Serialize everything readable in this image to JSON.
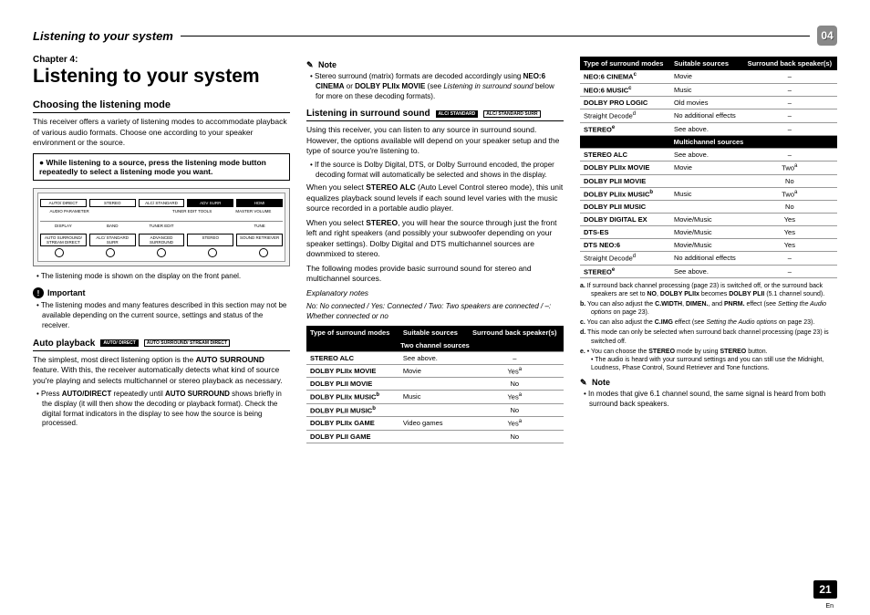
{
  "header": {
    "title": "Listening to your system",
    "chapter_badge": "04"
  },
  "col1": {
    "chapter_label": "Chapter 4:",
    "h1": "Listening to your system",
    "h2": "Choosing the listening mode",
    "p1": "This receiver offers a variety of listening modes to accommodate playback of various audio formats. Choose one according to your speaker environment or the source.",
    "box": "While listening to a source, press the listening mode button repeatedly to select a listening mode you want.",
    "note1": "The listening mode is shown on the display on the front panel.",
    "important_h": "Important",
    "important_p": "The listening modes and many features described in this section may not be available depending on the current source, settings and status of the receiver.",
    "auto_h": "Auto playback",
    "auto_btn1": "AUTO/\nDIRECT",
    "auto_btn2": "AUTO SURROUND/\nSTREAM DIRECT",
    "auto_p": "The simplest, most direct listening option is the AUTO SURROUND feature. With this, the receiver automatically detects what kind of source you're playing and selects multichannel or stereo playback as necessary.",
    "auto_note": "Press AUTO/DIRECT repeatedly until AUTO SURROUND shows briefly in the display (it will then show the decoding or playback format). Check the digital format indicators in the display to see how the source is being processed.",
    "device": {
      "row1": [
        "AUTO/\nDIRECT",
        "STEREO",
        "ALC/\nSTANDARD",
        "ADV SURR"
      ],
      "row1b": [
        "HDMI"
      ],
      "row2a": [
        "AUDIO\nPARAMETER",
        "",
        "TUNER EDIT\nTOOLS",
        "MASTER\nVOLUME"
      ],
      "row3": [
        "DISPLAY",
        "BAND",
        "TUNER EDIT",
        "",
        "TUNE"
      ],
      "row4": [
        "AUTO SURROUND/\nSTREAM DIRECT",
        "ALC/\nSTANDARD SURR",
        "ADVANCED\nSURROUND",
        "STEREO",
        "SOUND\nRETRIEVER"
      ]
    }
  },
  "col2": {
    "note_h": "Note",
    "note_p": "Stereo surround (matrix) formats are decoded accordingly using NEO:6 CINEMA or DOLBY PLIIx MOVIE (see Listening in surround sound below for more on these decoding formats).",
    "h3": "Listening in surround sound",
    "btn1": "ALC/\nSTANDARD",
    "btn2": "ALC/\nSTANDARD SURR",
    "p1": "Using this receiver, you can listen to any source in surround sound. However, the options available will depend on your speaker setup and the type of source you're listening to.",
    "bullet1": "If the source is Dolby Digital, DTS, or Dolby Surround encoded, the proper decoding format will automatically be selected and shows in the display.",
    "p2": "When you select STEREO ALC (Auto Level Control stereo mode), this unit equalizes playback sound levels if each sound level varies with the music source recorded in a portable audio player.",
    "p3": "When you select STEREO, you will hear the source through just the front left and right speakers (and possibly your subwoofer depending on your speaker settings). Dolby Digital and DTS multichannel sources are downmixed to stereo.",
    "p4": "The following modes provide basic surround sound for stereo and multichannel sources.",
    "exp_h": "Explanatory notes",
    "exp_p": "No: No connected / Yes: Connected / Two: Two speakers are connected / –: Whether connected or no",
    "th1": "Type of surround modes",
    "th2": "Suitable sources",
    "th3": "Surround back speaker(s)",
    "sec1": "Two channel sources",
    "rows": [
      {
        "m": "STEREO ALC",
        "s": "See above.",
        "b": "–"
      },
      {
        "m": "DOLBY PLIIx MOVIE",
        "s": "Movie",
        "b": "Yes",
        "sup": "a"
      },
      {
        "m": "DOLBY PLII MOVIE",
        "s": "",
        "b": "No"
      },
      {
        "m": "DOLBY PLIIx MUSIC",
        "msup": "b",
        "s": "Music",
        "b": "Yes",
        "sup": "a"
      },
      {
        "m": "DOLBY PLII MUSIC",
        "msup": "b",
        "s": "",
        "b": "No"
      },
      {
        "m": "DOLBY PLIIx GAME",
        "s": "Video games",
        "b": "Yes",
        "sup": "a"
      },
      {
        "m": "DOLBY PLII GAME",
        "s": "",
        "b": "No"
      }
    ]
  },
  "col3": {
    "th1": "Type of surround modes",
    "th2": "Suitable sources",
    "th3": "Surround back speaker(s)",
    "rows1": [
      {
        "m": "NEO:6 CINEMA",
        "msup": "c",
        "s": "Movie",
        "b": "–"
      },
      {
        "m": "NEO:6 MUSIC",
        "msup": "c",
        "s": "Music",
        "b": "–"
      },
      {
        "m": "DOLBY PRO LOGIC",
        "s": "Old movies",
        "b": "–"
      },
      {
        "m": "Straight Decode",
        "msup": "d",
        "s": "No additional effects",
        "b": "–",
        "plain": true
      },
      {
        "m": "STEREO",
        "msup": "e",
        "s": "See above.",
        "b": "–"
      }
    ],
    "sec2": "Multichannel sources",
    "rows2": [
      {
        "m": "STEREO ALC",
        "s": "See above.",
        "b": "–"
      },
      {
        "m": "DOLBY PLIIx MOVIE",
        "s": "Movie",
        "b": "Two",
        "sup": "a"
      },
      {
        "m": "DOLBY PLII MOVIE",
        "s": "",
        "b": "No"
      },
      {
        "m": "DOLBY PLIIx MUSIC",
        "msup": "b",
        "s": "Music",
        "b": "Two",
        "sup": "a"
      },
      {
        "m": "DOLBY PLII MUSIC",
        "s": "",
        "b": "No"
      },
      {
        "m": "DOLBY DIGITAL EX",
        "s": "Movie/Music",
        "b": "Yes"
      },
      {
        "m": "DTS-ES",
        "s": "Movie/Music",
        "b": "Yes"
      },
      {
        "m": "DTS NEO:6",
        "s": "Movie/Music",
        "b": "Yes"
      },
      {
        "m": "Straight Decode",
        "msup": "d",
        "s": "No additional effects",
        "b": "–",
        "plain": true
      },
      {
        "m": "STEREO",
        "msup": "e",
        "s": "See above.",
        "b": "–"
      }
    ],
    "foot": {
      "a": "If surround back channel processing (page 23) is switched off, or the surround back speakers are set to NO, DOLBY PLIIx becomes DOLBY PLII (5.1 channel sound).",
      "b": "You can also adjust the C.WIDTH, DIMEN., and PNRM. effect (see Setting the Audio options on page 23).",
      "c": "You can also adjust the C.IMG effect (see Setting the Audio options on page 23).",
      "d": "This mode can only be selected when surround back channel processing (page 23) is switched off.",
      "e": "• You can choose the STEREO mode by using STEREO button.\n• The audio is heard with your surround settings and you can still use the Midnight, Loudness, Phase Control, Sound Retriever and Tone functions."
    },
    "note_h": "Note",
    "note_p": "In modes that give 6.1 channel sound, the same signal is heard from both surround back speakers."
  },
  "page": {
    "num": "21",
    "lang": "En"
  }
}
